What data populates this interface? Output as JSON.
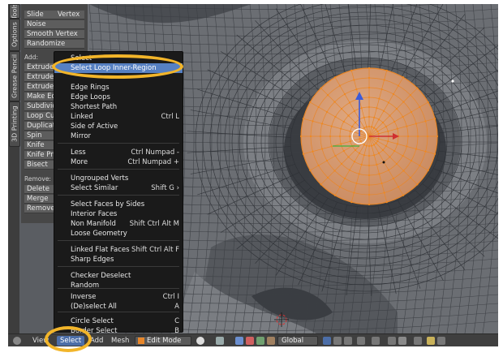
{
  "tabs": {
    "tools": "Tools",
    "options": "Options",
    "grease_pencil": "Grease Pencil",
    "printing": "3D Printing"
  },
  "shelf": {
    "top_items": [
      "Slide",
      "Vertex",
      "Noise",
      "Smooth Vertex",
      "Randomize"
    ],
    "add_label": "Add:",
    "add_items": [
      "Extrude",
      "Extrude I",
      "Extrude I",
      "Make Ed",
      "Subdivid",
      "Loop Cut",
      "Duplicat",
      "Spin",
      "Knife",
      "Knife Pro",
      "Bisect"
    ],
    "spin_extra": "S",
    "remove_label": "Remove:",
    "remove_items": [
      "Delete",
      "Merge",
      "Remove"
    ]
  },
  "menu": {
    "partial_top": "Select",
    "highlighted": "Select Loop Inner-Region",
    "items": [
      {
        "label": "Edge Rings",
        "shortcut": ""
      },
      {
        "label": "Edge Loops",
        "shortcut": ""
      },
      {
        "label": "Shortest Path",
        "shortcut": ""
      },
      {
        "label": "Linked",
        "shortcut": "Ctrl L"
      },
      {
        "label": "Side of Active",
        "shortcut": ""
      },
      {
        "label": "Mirror",
        "shortcut": ""
      },
      {
        "label": "Less",
        "shortcut": "Ctrl Numpad -"
      },
      {
        "label": "More",
        "shortcut": "Ctrl Numpad +"
      },
      {
        "label": "Ungrouped Verts",
        "shortcut": ""
      },
      {
        "label": "Select Similar",
        "shortcut": "Shift G ›"
      },
      {
        "label": "Select Faces by Sides",
        "shortcut": ""
      },
      {
        "label": "Interior Faces",
        "shortcut": ""
      },
      {
        "label": "Non Manifold",
        "shortcut": "Shift Ctrl Alt M"
      },
      {
        "label": "Loose Geometry",
        "shortcut": ""
      },
      {
        "label": "Linked Flat Faces",
        "shortcut": "Shift Ctrl Alt F"
      },
      {
        "label": "Sharp Edges",
        "shortcut": ""
      },
      {
        "label": "Checker Deselect",
        "shortcut": ""
      },
      {
        "label": "Random",
        "shortcut": ""
      },
      {
        "label": "Inverse",
        "shortcut": "Ctrl I"
      },
      {
        "label": "(De)select All",
        "shortcut": "A"
      },
      {
        "label": "Circle Select",
        "shortcut": "C"
      },
      {
        "label": "Border Select",
        "shortcut": "B"
      }
    ]
  },
  "header": {
    "view": "View",
    "select": "Select",
    "add": "Add",
    "mesh": "Mesh",
    "mode": "Edit Mode",
    "orientation": "Global"
  },
  "colors": {
    "selection": "#ef8a2a",
    "highlight": "#5680c2",
    "annotation": "#f2b52a"
  }
}
